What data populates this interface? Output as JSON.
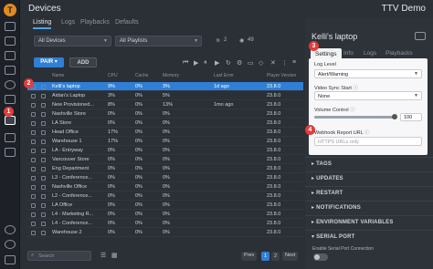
{
  "app": {
    "logo": "T",
    "title": "Devices",
    "org": "TTV Demo"
  },
  "badges": {
    "one": "1",
    "two": "2",
    "three": "3",
    "four": "4"
  },
  "tabs": [
    "Listing",
    "Logs",
    "Playbacks",
    "Defaults"
  ],
  "filters": {
    "devices": "All Devices",
    "playlists": "All Playlists",
    "wifi_count": "2",
    "group_count": "49"
  },
  "buttons": {
    "pair": "PAIR",
    "add": "ADD"
  },
  "table": {
    "headers": [
      "Name",
      "CPU",
      "Cache",
      "Memory",
      "Last Error",
      "Player Version"
    ],
    "rows": [
      [
        "Kelli's laptop",
        "9%",
        "0%",
        "3%",
        "1d ago",
        "23.8.0"
      ],
      [
        "Aidan's Laptop",
        "3%",
        "0%",
        "5%",
        "",
        "23.8.0"
      ],
      [
        "New Provisioned...",
        "8%",
        "0%",
        "13%",
        "1mo ago",
        "23.8.0"
      ],
      [
        "Nashville Store",
        "0%",
        "0%",
        "0%",
        "",
        "23.8.0"
      ],
      [
        "LA Store",
        "0%",
        "0%",
        "0%",
        "",
        "23.8.0"
      ],
      [
        "Head Office",
        "17%",
        "0%",
        "0%",
        "",
        "23.8.0"
      ],
      [
        "Warehouse 1",
        "17%",
        "0%",
        "0%",
        "",
        "23.8.0"
      ],
      [
        "LA - Entryway",
        "0%",
        "0%",
        "0%",
        "",
        "23.8.0"
      ],
      [
        "Vancouver Store",
        "0%",
        "0%",
        "0%",
        "",
        "23.8.0"
      ],
      [
        "Eng Department",
        "0%",
        "0%",
        "0%",
        "",
        "23.8.0"
      ],
      [
        "L3 - Conference...",
        "0%",
        "0%",
        "0%",
        "",
        "23.8.0"
      ],
      [
        "Nashville Office",
        "0%",
        "0%",
        "0%",
        "",
        "23.8.0"
      ],
      [
        "L2 - Conference...",
        "0%",
        "0%",
        "0%",
        "",
        "23.8.0"
      ],
      [
        "LA Office",
        "0%",
        "0%",
        "0%",
        "",
        "23.8.0"
      ],
      [
        "L4 - Marketing R...",
        "0%",
        "0%",
        "0%",
        "",
        "23.8.0"
      ],
      [
        "L4 - Conference...",
        "0%",
        "0%",
        "0%",
        "",
        "23.8.0"
      ],
      [
        "Warehouse 2",
        "0%",
        "0%",
        "0%",
        "",
        "23.8.0"
      ]
    ]
  },
  "pager": {
    "search_placeholder": "Search",
    "prev": "Prev",
    "p1": "1",
    "p2": "2",
    "next": "Next"
  },
  "right": {
    "device_name": "Kelli's laptop",
    "tabs": [
      "Settings",
      "Info",
      "Logs",
      "Playbacks"
    ],
    "log_level_label": "Log Level",
    "log_level_value": "Alert/Warning",
    "vsync_label": "Video Sync Start",
    "vsync_value": "None",
    "volume_label": "Volume Control",
    "volume_value": "100",
    "volume_level": 1.0,
    "webhook_label": "Webhook Report URL",
    "webhook_placeholder": "HTTPS URLs only",
    "sections": [
      "TAGS",
      "UPDATES",
      "RESTART",
      "NOTIFICATIONS",
      "ENVIRONMENT VARIABLES",
      "SERIAL PORT"
    ],
    "serial_label": "Enable Serial Port Connection"
  },
  "colors": {
    "accent": "#2f7fd6",
    "badge": "#e23c3c",
    "orange": "#e18a20"
  }
}
